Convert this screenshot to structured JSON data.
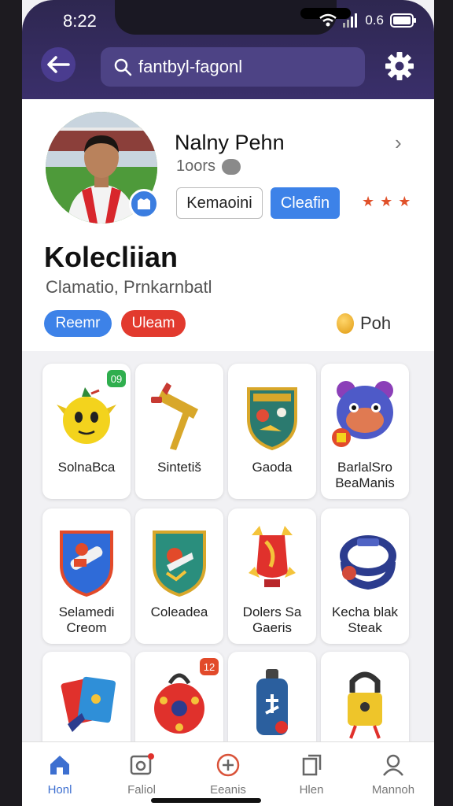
{
  "status": {
    "time": "8:22",
    "battery": "0.6"
  },
  "search": {
    "value": "fantbyl-fagonl"
  },
  "profile": {
    "name": "Nalny Pehn",
    "sub": "1oors",
    "btn_outline": "Kemaoini",
    "btn_fill": "Cleafin",
    "stars": "★ ★ ★",
    "title": "Kolecliian",
    "subtitle": "Clamatio, Prnkarnbatl",
    "chip_blue": "Reemr",
    "chip_red": "Uleam",
    "coin_text": "Poh"
  },
  "cards": [
    {
      "label": "SolnaBca",
      "icon": "yellow-creature-icon",
      "badge": "09",
      "badge_color": "#2fae4e"
    },
    {
      "label": "Sintetiš",
      "icon": "hammer-icon"
    },
    {
      "label": "Gaoda",
      "icon": "shield-crest-icon"
    },
    {
      "label": "BarlalSro\nBeaManis",
      "icon": "purple-bear-icon"
    },
    {
      "label": "Selamedi\nCreom",
      "icon": "blue-shield-icon"
    },
    {
      "label": "Coleadea",
      "icon": "green-shield-icon"
    },
    {
      "label": "Dolers Sa\nGaeris",
      "icon": "red-trophy-icon"
    },
    {
      "label": "Kecha blak\nSteak",
      "icon": "wristband-icon"
    },
    {
      "label": "",
      "icon": "card-packs-icon"
    },
    {
      "label": "",
      "icon": "red-ball-bag-icon",
      "badge": "12",
      "badge_color": "#e24a2a"
    },
    {
      "label": "",
      "icon": "bottle-icon"
    },
    {
      "label": "",
      "icon": "yellow-lock-icon"
    }
  ],
  "nav": [
    {
      "label": "Honl",
      "icon": "home-icon",
      "active": true
    },
    {
      "label": "Faliol",
      "icon": "gallery-icon"
    },
    {
      "label": "Eeanis",
      "icon": "plus-circle-icon"
    },
    {
      "label": "Hlen",
      "icon": "bookmark-icon"
    },
    {
      "label": "Mannoh",
      "icon": "profile-icon"
    }
  ],
  "colors": {
    "header": "#2e2750",
    "accent_blue": "#3d82e8",
    "accent_red": "#e23a2e",
    "nav_active": "#3d6fd0"
  }
}
